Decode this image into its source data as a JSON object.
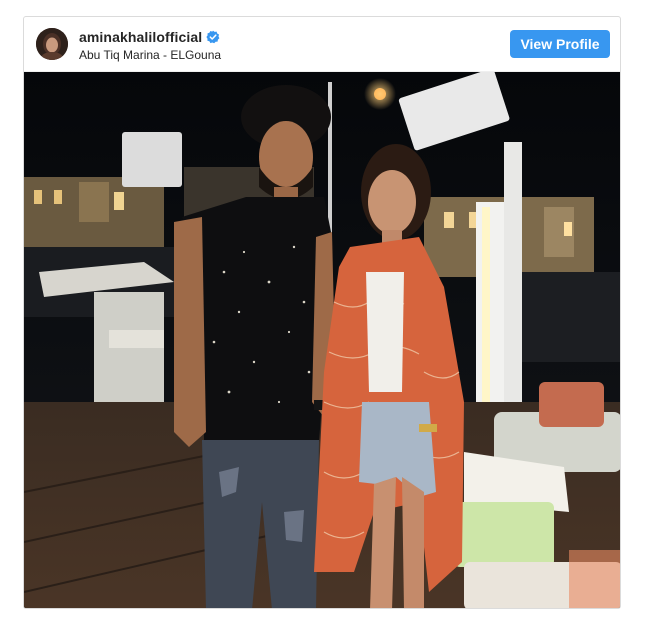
{
  "post": {
    "username": "aminakhalilofficial",
    "verified": true,
    "location": "Abu Tiq Marina - ELGouna",
    "view_profile_label": "View Profile"
  },
  "icons": {
    "verified": "verified-badge-icon",
    "avatar": "profile-avatar"
  },
  "colors": {
    "button_bg": "#3897f0",
    "verified_badge": "#3897f0",
    "text_primary": "#262626",
    "border": "#dbdbdb"
  },
  "photo": {
    "subject": "two people standing on a lit marina deck at night"
  }
}
